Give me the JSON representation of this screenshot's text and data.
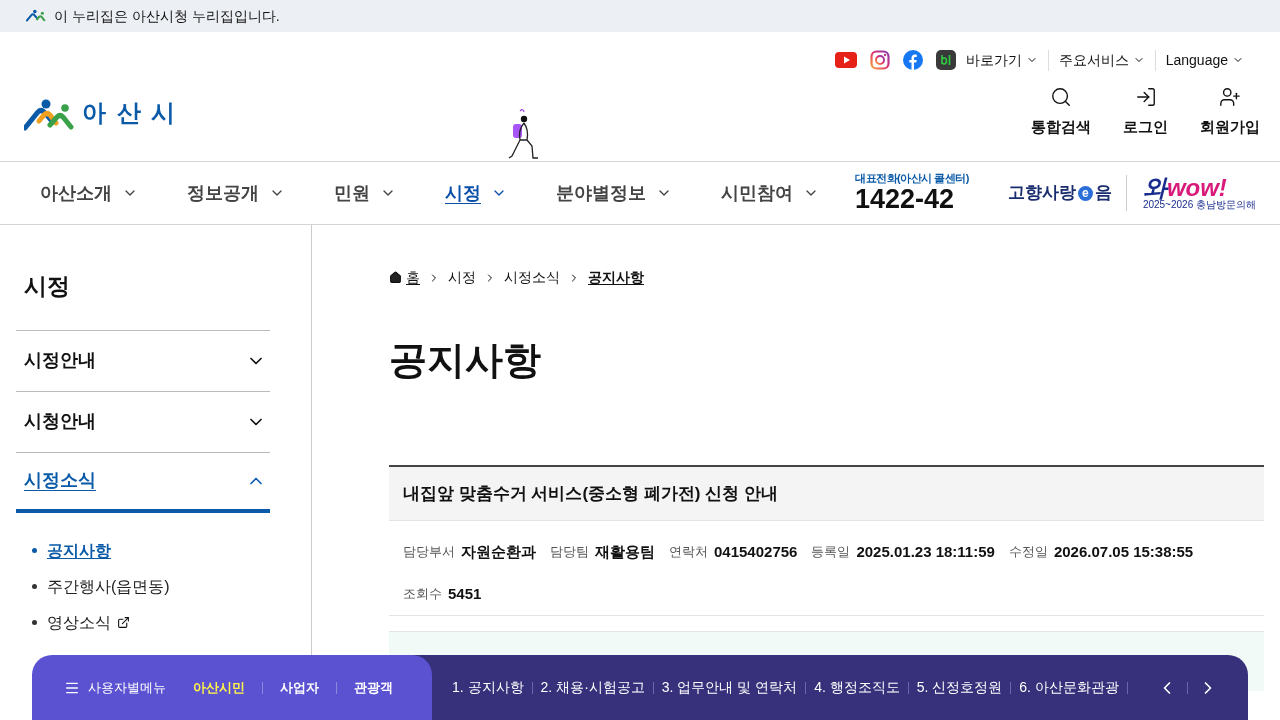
{
  "notice_banner": {
    "text": "이 누리집은 아산시청 누리집입니다."
  },
  "header": {
    "logo_text": "아 산 시",
    "social": [
      {
        "kind": "youtube"
      },
      {
        "kind": "instagram"
      },
      {
        "kind": "facebook"
      },
      {
        "kind": "blog"
      }
    ],
    "utility_links": [
      {
        "label": "바로가기"
      },
      {
        "label": "주요서비스"
      },
      {
        "label": "Language"
      }
    ],
    "actions": [
      {
        "label": "통합검색",
        "kind": "search"
      },
      {
        "label": "로그인",
        "kind": "login"
      },
      {
        "label": "회원가입",
        "kind": "signup"
      }
    ]
  },
  "nav": {
    "items": [
      {
        "label": "아산소개",
        "selected": false
      },
      {
        "label": "정보공개",
        "selected": false
      },
      {
        "label": "민원",
        "selected": false
      },
      {
        "label": "시정",
        "selected": true
      },
      {
        "label": "분야별정보",
        "selected": false
      },
      {
        "label": "시민참여",
        "selected": false
      }
    ],
    "phone": {
      "caption": "대표전화(아산시 콜센터)",
      "number": "1422-42"
    },
    "hometown_banner": {
      "text_before": "고향사랑",
      "mark": "e",
      "text_after": "음"
    },
    "visit_banner": {
      "title_a": "와",
      "title_b": "wow!",
      "caption": "2025~2026 충남방문의해"
    }
  },
  "sidebar": {
    "title": "시정",
    "groups": [
      {
        "label": "시정안내",
        "expanded": false
      },
      {
        "label": "시청안내",
        "expanded": false
      },
      {
        "label": "시정소식",
        "expanded": true,
        "children": [
          {
            "label": "공지사항",
            "selected": true,
            "external": false
          },
          {
            "label": "주간행사(읍면동)",
            "selected": false,
            "external": false
          },
          {
            "label": "영상소식",
            "selected": false,
            "external": true
          }
        ]
      }
    ]
  },
  "breadcrumb": [
    {
      "label": "홈",
      "kind": "home"
    },
    {
      "label": "시정",
      "kind": "crumb"
    },
    {
      "label": "시정소식",
      "kind": "crumb"
    },
    {
      "label": "공지사항",
      "kind": "current"
    }
  ],
  "page_title": "공지사항",
  "post": {
    "title": "내집앞 맞춤수거 서비스(중소형 폐가전) 신청 안내",
    "meta": [
      {
        "label": "담당부서",
        "value": "자원순환과"
      },
      {
        "label": "담당팀",
        "value": "재활용팀"
      },
      {
        "label": "연락처",
        "value": "0415402756"
      },
      {
        "label": "등록일",
        "value": "2025.01.23 18:11:59"
      },
      {
        "label": "수정일",
        "value": "2026.07.05 15:38:55"
      },
      {
        "label": "조회수",
        "value": "5451"
      }
    ]
  },
  "bottom_bar": {
    "menu_label": "사용자별메뉴",
    "tabs": [
      {
        "label": "아산시민",
        "selected": true
      },
      {
        "label": "사업자",
        "selected": false
      },
      {
        "label": "관광객",
        "selected": false
      }
    ],
    "links": [
      "1. 공지사항",
      "2. 채용·시험공고",
      "3. 업무안내 및 연락처",
      "4. 행정조직도",
      "5. 신정호정원",
      "6. 아산문화관광"
    ]
  }
}
